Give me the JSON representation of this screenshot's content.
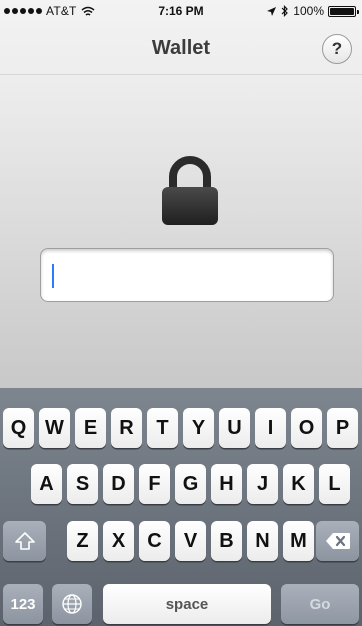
{
  "status_bar": {
    "carrier": "AT&T",
    "time": "7:16 PM",
    "battery": "100%",
    "signal_icon": "signal-dots-icon",
    "wifi_icon": "wifi-icon",
    "location_icon": "location-arrow-icon",
    "bluetooth_icon": "bluetooth-icon",
    "battery_icon": "battery-icon",
    "battery_level": 1.0
  },
  "nav": {
    "title": "Wallet",
    "help_label": "?"
  },
  "lock_icon": "lock-icon",
  "password_field": {
    "value": "",
    "placeholder": ""
  },
  "keyboard": {
    "row1": [
      "Q",
      "W",
      "E",
      "R",
      "T",
      "Y",
      "U",
      "I",
      "O",
      "P"
    ],
    "row2": [
      "A",
      "S",
      "D",
      "F",
      "G",
      "H",
      "J",
      "K",
      "L"
    ],
    "row3": [
      "Z",
      "X",
      "C",
      "V",
      "B",
      "N",
      "M"
    ],
    "shift_icon": "shift-arrow-icon",
    "backspace_icon": "backspace-icon",
    "numbers_label": "123",
    "globe_icon": "globe-icon",
    "space_label": "space",
    "go_label": "Go"
  },
  "colors": {
    "background_top": "#f3f3f3",
    "background_bottom": "#b8b8b8",
    "keyboard_bg": "#6f7680",
    "cursor": "#2f7bff"
  }
}
